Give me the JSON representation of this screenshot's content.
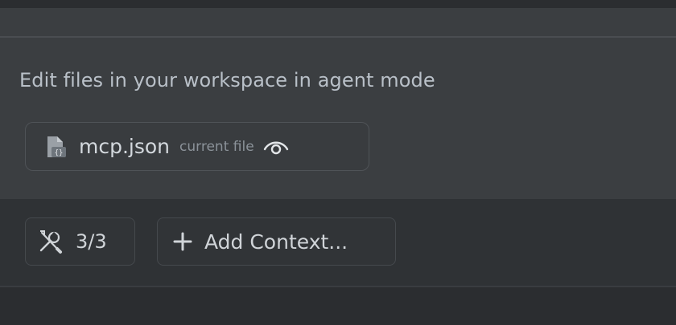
{
  "prompt": {
    "hint": "Edit files in your workspace in agent mode"
  },
  "context_chip": {
    "file_name": "mcp.json",
    "sublabel": "current file",
    "file_icon": "json-file-icon",
    "visibility_icon": "eye-icon"
  },
  "toolbar": {
    "tools_icon": "tools-icon",
    "tools_count": "3/3",
    "add_icon": "plus-icon",
    "add_context_label": "Add Context..."
  },
  "colors": {
    "panel_bg": "#3b3e41",
    "toolbar_bg": "#2f3235",
    "text_primary": "#d0d4d8",
    "text_muted": "#8b9299"
  }
}
